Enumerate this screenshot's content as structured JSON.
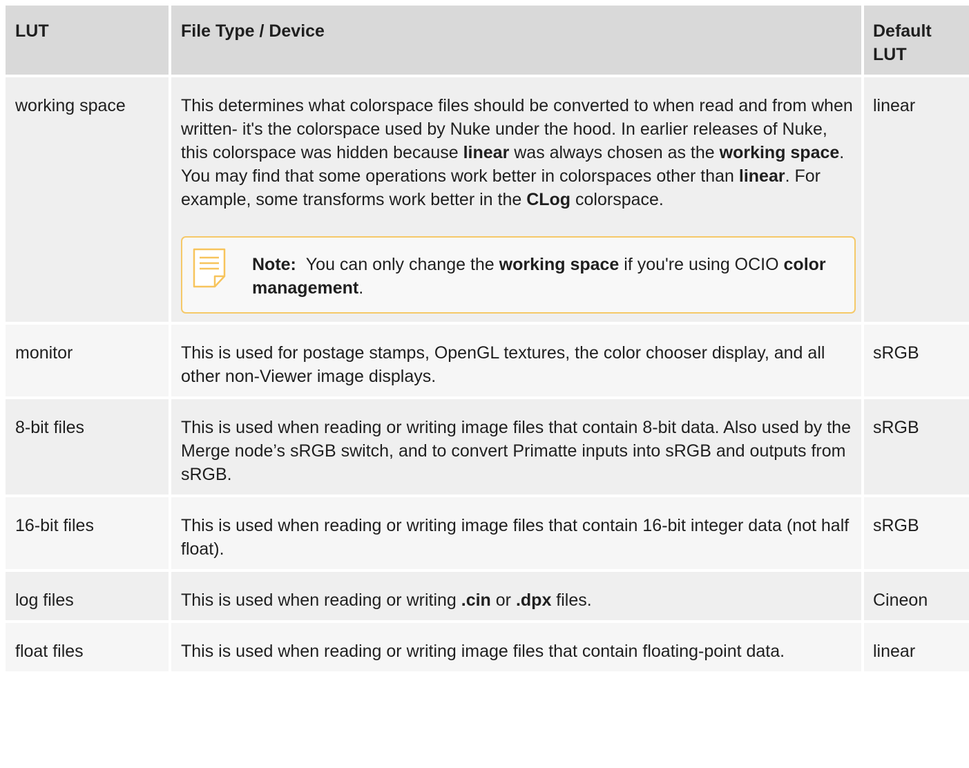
{
  "table": {
    "headers": [
      "LUT",
      "File Type / Device",
      "Default LUT"
    ],
    "rows": [
      {
        "lut": "working space",
        "desc_parts": [
          "This determines what colorspace files should be converted to when read and from when written- it's the colorspace used by Nuke under the hood. In earlier releases of Nuke, this colorspace was hidden because ",
          "linear",
          " was always chosen as the ",
          "working space",
          ". You may find that some operations work better in colorspaces other than ",
          "linear",
          ". For example, some transforms work better in the ",
          "CLog",
          " colorspace."
        ],
        "note": {
          "icon": "note-document-icon",
          "label": "Note:",
          "parts": [
            "You can only change the ",
            "working space",
            " if you're using OCIO ",
            "color management",
            "."
          ]
        },
        "default": "linear"
      },
      {
        "lut": "monitor",
        "desc": "This is used for postage stamps, OpenGL textures, the color chooser display, and all other non-Viewer image displays.",
        "default": "sRGB"
      },
      {
        "lut": "8-bit files",
        "desc": "This is used when reading or writing image files that contain 8-bit data. Also used by the Merge node’s sRGB switch, and to convert Primatte inputs into sRGB and outputs from sRGB.",
        "default": "sRGB"
      },
      {
        "lut": "16-bit files",
        "desc": "This is used when reading or writing image files that contain 16-bit integer data (not half float).",
        "default": "sRGB"
      },
      {
        "lut": "log files",
        "desc_parts": [
          "This is used when reading or writing ",
          ".cin",
          " or ",
          ".dpx",
          " files."
        ],
        "default": "Cineon"
      },
      {
        "lut": "float files",
        "desc": "This is used when reading or writing image files that contain floating-point data.",
        "default": "linear"
      }
    ]
  },
  "colors": {
    "header_bg": "#d9d9d9",
    "row_bg_odd": "#efefef",
    "row_bg_even": "#f6f6f6",
    "note_border": "#f5c969",
    "note_icon": "#f7c45c"
  }
}
